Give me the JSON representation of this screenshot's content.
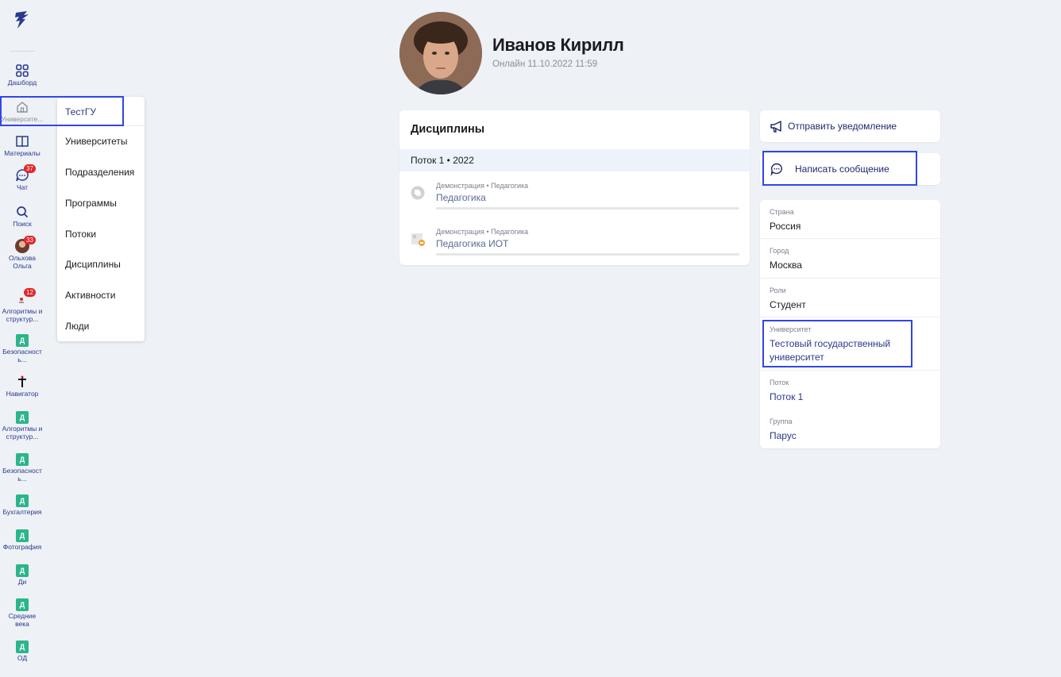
{
  "sidebar": {
    "items": [
      {
        "label": "Дашборд",
        "icon": "grid-icon"
      },
      {
        "label": "Университе...",
        "icon": "home-icon"
      },
      {
        "label": "Материалы",
        "icon": "book-icon"
      },
      {
        "label": "Чат",
        "icon": "chat-icon",
        "badge": "37"
      },
      {
        "label": "Поиск",
        "icon": "search-icon"
      },
      {
        "label": "Ольхова Ольга",
        "icon": "avatar",
        "badge": "33"
      },
      {
        "label": "Алгоритмы и структур...",
        "badge": "12"
      },
      {
        "label": "Безопасност ь...",
        "letter": "Д"
      },
      {
        "label": "Навигатор"
      },
      {
        "label": "Алгоритмы и структур...",
        "letter": "Д"
      },
      {
        "label": "Безопасност ь...",
        "letter": "Д"
      },
      {
        "label": "Бухгалтерия",
        "letter": "Д"
      },
      {
        "label": "Фотография",
        "letter": "Д"
      },
      {
        "label": "Ди",
        "letter": "Д"
      },
      {
        "label": "Средние века",
        "letter": "Д"
      },
      {
        "label": "ОД",
        "letter": "Д"
      }
    ]
  },
  "dropdown": {
    "items": [
      "ТестГУ",
      "Университеты",
      "Подразделения",
      "Программы",
      "Потоки",
      "Дисциплины",
      "Активности",
      "Люди"
    ]
  },
  "profile": {
    "name": "Иванов Кирилл",
    "status": "Онлайн 11.10.2022 11:59"
  },
  "disciplines": {
    "title": "Дисциплины",
    "stream": "Поток 1 • 2022",
    "courses": [
      {
        "meta": "Демонстрация • Педагогика",
        "name": "Педагогика"
      },
      {
        "meta": "Демонстрация • Педагогика",
        "name": "Педагогика ИОТ"
      }
    ]
  },
  "actions": {
    "notify": "Отправить уведомление",
    "message": "Написать сообщение"
  },
  "info": {
    "fields": [
      {
        "label": "Страна",
        "value": "Россия"
      },
      {
        "label": "Город",
        "value": "Москва"
      },
      {
        "label": "Роли",
        "value": "Студент"
      },
      {
        "label": "Университет",
        "value": "Тестовый государственный университет"
      },
      {
        "label": "Поток",
        "value": "Поток 1"
      },
      {
        "label": "Группа",
        "value": "Парус"
      }
    ]
  },
  "colors": {
    "accent": "#2a3a8c",
    "badge": "#e0262a",
    "course_letter_bg": "#2bb58c",
    "highlight": "#3146e6"
  }
}
